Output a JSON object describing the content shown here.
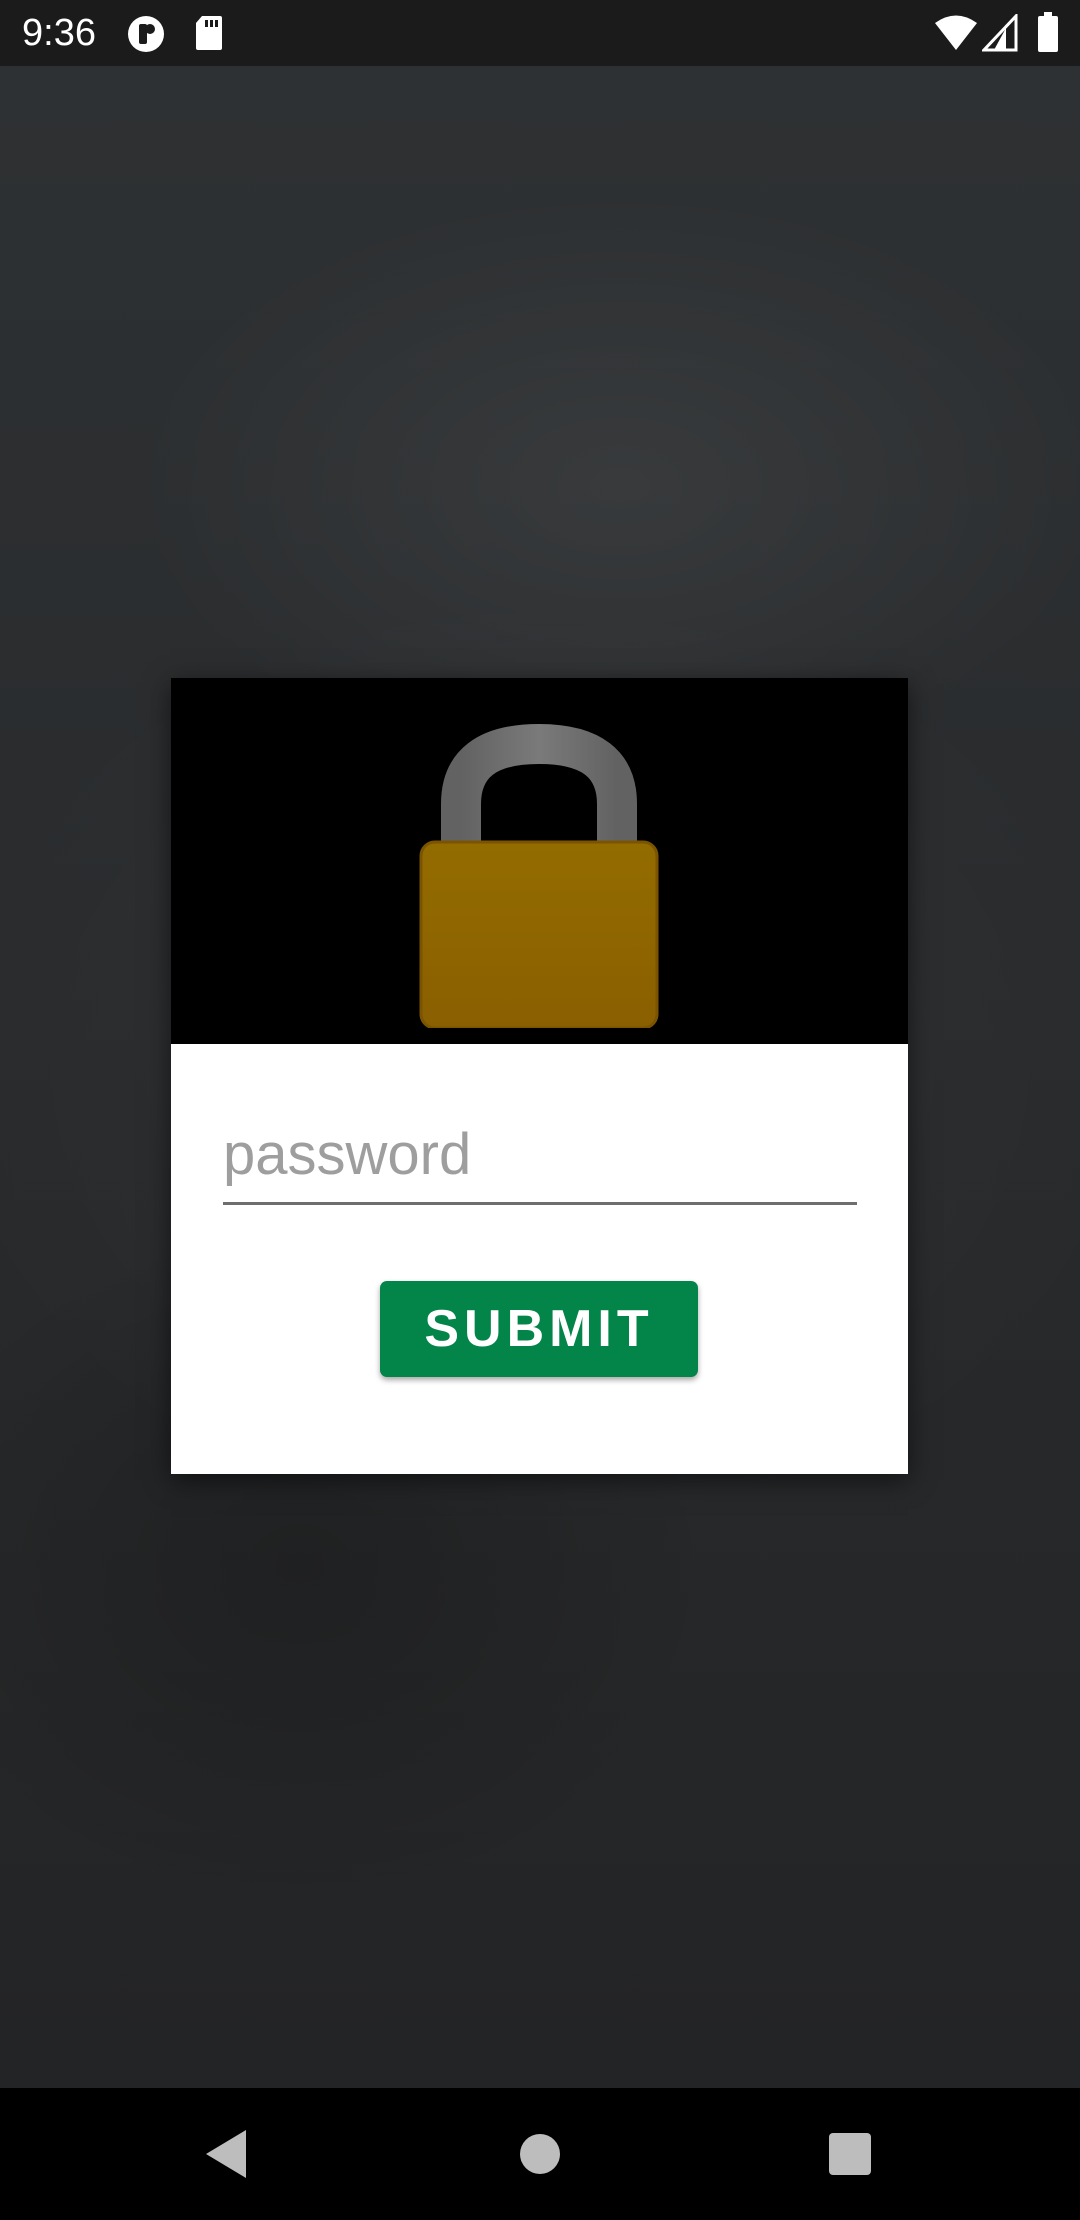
{
  "status_bar": {
    "time": "9:36",
    "left_icons": [
      "notification-app-icon",
      "sd-card-icon"
    ],
    "right_icons": [
      "wifi-icon",
      "cellular-signal-icon",
      "battery-icon"
    ]
  },
  "dialog": {
    "header_icon": "padlock-icon",
    "password": {
      "value": "",
      "placeholder": "password"
    },
    "submit_label": "SUBMIT"
  },
  "nav_bar": {
    "buttons": [
      "back-icon",
      "home-icon",
      "recents-icon"
    ]
  },
  "colors": {
    "submit_button": "#03854a",
    "lock_body": "#8f6600",
    "lock_shackle": "#707070",
    "dialog_header": "#000000"
  }
}
